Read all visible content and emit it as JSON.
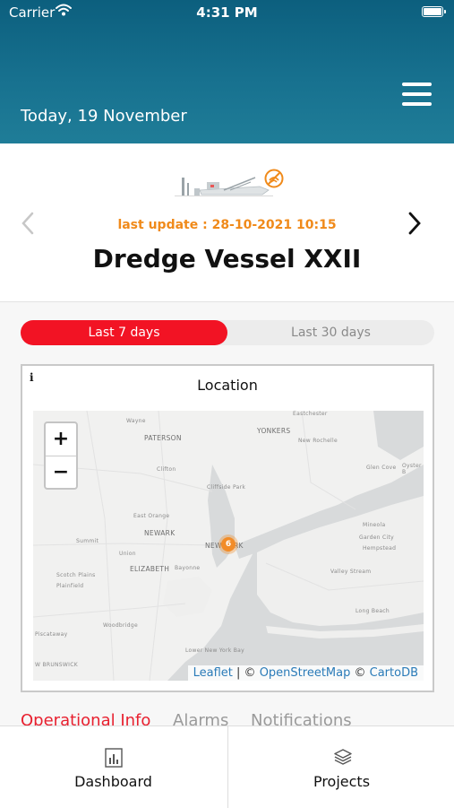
{
  "status_bar": {
    "carrier": "Carrier",
    "time": "4:31 PM"
  },
  "header": {
    "date": "Today, 19 November"
  },
  "vessel": {
    "last_update": "last update : 28-10-2021 10:15",
    "name": "Dredge Vessel XXII"
  },
  "period": {
    "options": [
      "Last 7 days",
      "Last 30 days"
    ],
    "selected": "Last 7 days"
  },
  "map_card": {
    "info": "i",
    "title": "Location",
    "zoom_in": "+",
    "zoom_out": "−",
    "marker_count": "6",
    "attribution": {
      "leaflet": "Leaflet",
      "sep1": " | © ",
      "osm": "OpenStreetMap",
      "sep2": " © ",
      "carto": "CartoDB"
    },
    "labels": [
      "Wayne",
      "PATERSON",
      "YONKERS",
      "Eastchester",
      "New Rochelle",
      "Clifton",
      "Glen Cove",
      "Oyster B",
      "Cliffside Park",
      "East Orange",
      "NEWARK",
      "NEW YORK",
      "Mineola",
      "Garden City",
      "Hempstead",
      "Summit",
      "Union",
      "ELIZABETH",
      "Bayonne",
      "Valley Stream",
      "Scotch Plains",
      "Plainfield",
      "Long Beach",
      "Woodbridge",
      "W BRUNSWICK",
      "Piscataway",
      "Lower New York Bay"
    ]
  },
  "tabs": [
    "Operational Info",
    "Alarms",
    "Notifications"
  ],
  "bottom_nav": [
    "Dashboard",
    "Projects"
  ],
  "colors": {
    "header": "#17718f",
    "accent_red": "#f21324",
    "accent_orange": "#f08a1a",
    "link": "#2a7bb8"
  }
}
